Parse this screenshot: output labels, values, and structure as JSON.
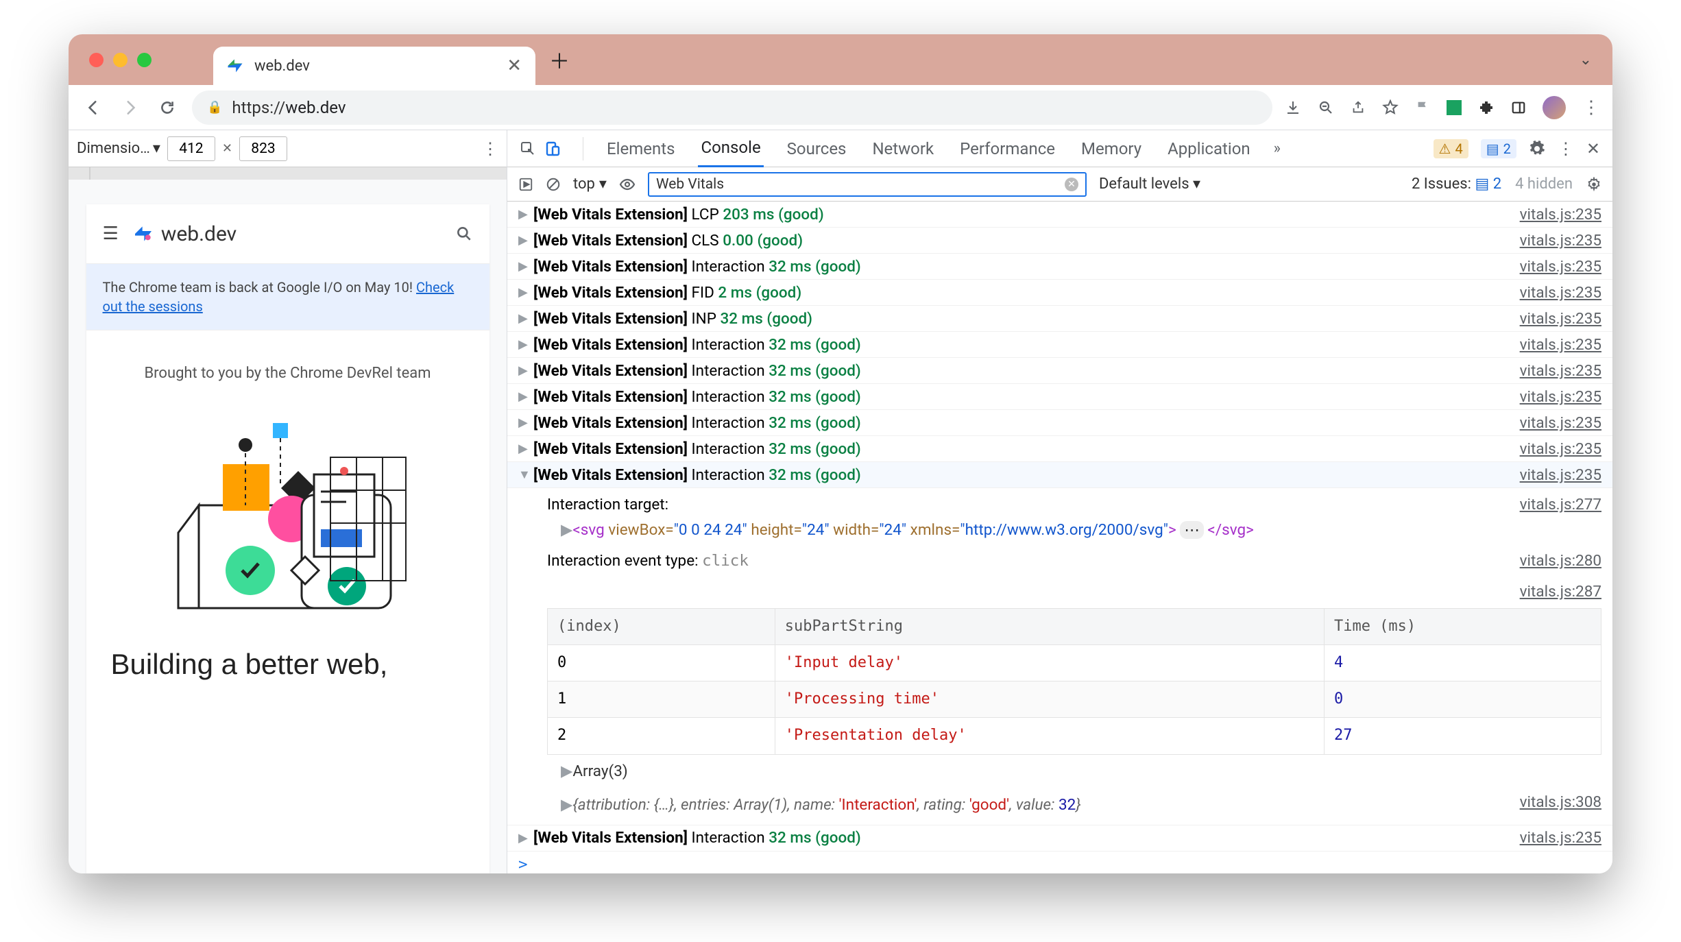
{
  "browser": {
    "tab_title": "web.dev",
    "url_display": "https://web.dev",
    "url_scheme": "https://",
    "url_host": "web.dev"
  },
  "device_bar": {
    "label": "Dimensio…",
    "width": "412",
    "height": "823"
  },
  "site": {
    "logo_text": "web.dev",
    "banner_pre": "The Chrome team is back at Google I/O on May 10! ",
    "banner_link": "Check out the sessions",
    "lead": "Brought to you by the Chrome DevRel team",
    "hero": "Building a better web,"
  },
  "devtools": {
    "tabs": [
      "Elements",
      "Console",
      "Sources",
      "Network",
      "Performance",
      "Memory",
      "Application"
    ],
    "active_tab": "Console",
    "warn_badge": "4",
    "msg_badge": "2",
    "filter": {
      "scope": "top",
      "query": "Web Vitals",
      "levels": "Default levels",
      "issues_label": "2 Issues:",
      "issues_count": "2",
      "hidden": "4 hidden"
    },
    "source_prefix": "[Web Vitals Extension]",
    "rows": [
      {
        "metric": "LCP",
        "detail": "203 ms (good)",
        "src": "vitals.js:235",
        "sel": false
      },
      {
        "metric": "CLS",
        "detail": "0.00 (good)",
        "src": "vitals.js:235",
        "sel": false
      },
      {
        "metric": "Interaction",
        "detail": "32 ms (good)",
        "src": "vitals.js:235",
        "sel": false
      },
      {
        "metric": "FID",
        "detail": "2 ms (good)",
        "src": "vitals.js:235",
        "sel": false
      },
      {
        "metric": "INP",
        "detail": "32 ms (good)",
        "src": "vitals.js:235",
        "sel": false
      },
      {
        "metric": "Interaction",
        "detail": "32 ms (good)",
        "src": "vitals.js:235",
        "sel": false
      },
      {
        "metric": "Interaction",
        "detail": "32 ms (good)",
        "src": "vitals.js:235",
        "sel": false
      },
      {
        "metric": "Interaction",
        "detail": "32 ms (good)",
        "src": "vitals.js:235",
        "sel": false
      },
      {
        "metric": "Interaction",
        "detail": "32 ms (good)",
        "src": "vitals.js:235",
        "sel": false
      },
      {
        "metric": "Interaction",
        "detail": "32 ms (good)",
        "src": "vitals.js:235",
        "sel": false
      },
      {
        "metric": "Interaction",
        "detail": "32 ms (good)",
        "src": "vitals.js:235",
        "sel": true
      }
    ],
    "expand": {
      "target_label": "Interaction target:",
      "target_src": "vitals.js:277",
      "svg_viewBox": "0 0 24 24",
      "svg_h": "24",
      "svg_w": "24",
      "svg_xmlns": "http://www.w3.org/2000/svg",
      "event_label": "Interaction event type:",
      "event_type": "click",
      "event_src": "vitals.js:280",
      "table_src": "vitals.js:287",
      "headers": [
        "(index)",
        "subPartString",
        "Time (ms)"
      ],
      "trows": [
        {
          "i": "0",
          "s": "'Input delay'",
          "t": "4"
        },
        {
          "i": "1",
          "s": "'Processing time'",
          "t": "0"
        },
        {
          "i": "2",
          "s": "'Presentation delay'",
          "t": "27"
        }
      ],
      "array_label": "Array(3)",
      "obj_line_parts": {
        "attr": "attribution:",
        "attr_v": "{…}",
        "ent": "entries:",
        "ent_v": "Array(1)",
        "name": "name:",
        "name_v": "'Interaction'",
        "rating": "rating:",
        "rating_v": "'good'",
        "value": "value:",
        "value_v": "32"
      },
      "obj_src": "vitals.js:308",
      "final_row": {
        "metric": "Interaction",
        "detail": "32 ms (good)",
        "src": "vitals.js:235"
      }
    }
  }
}
